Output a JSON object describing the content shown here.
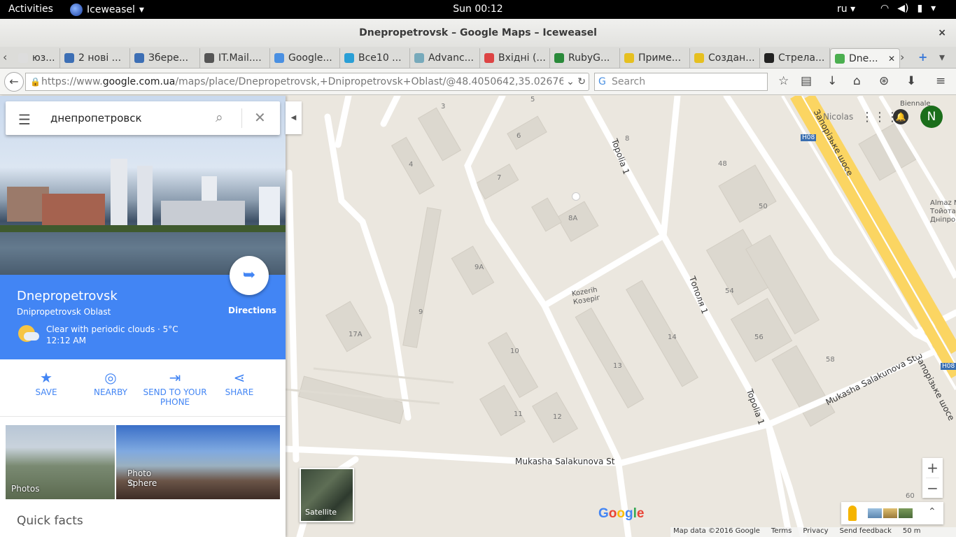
{
  "system": {
    "activities": "Activities",
    "app": "Iceweasel",
    "clock": "Sun 00:12",
    "lang": "ru"
  },
  "window": {
    "title": "Dnepropetrovsk – Google Maps – Iceweasel",
    "close": "×"
  },
  "tabs": [
    {
      "label": "юз...",
      "color": "#ddd"
    },
    {
      "label": "2 нові ...",
      "color": "#3d6fb5"
    },
    {
      "label": "Збере...",
      "color": "#3d6fb5"
    },
    {
      "label": "IT.Mail....",
      "color": "#555"
    },
    {
      "label": "Google...",
      "color": "#4a90e2"
    },
    {
      "label": "Все10 ...",
      "color": "#2a9fd6"
    },
    {
      "label": "Advanc...",
      "color": "#7ab"
    },
    {
      "label": "Вхідні (...",
      "color": "#d44"
    },
    {
      "label": "RubyG...",
      "color": "#2a8a3a"
    },
    {
      "label": "Приме...",
      "color": "#e6c020"
    },
    {
      "label": "Создан...",
      "color": "#e6c020"
    },
    {
      "label": "Стрела...",
      "color": "#222"
    },
    {
      "label": "Dne...",
      "color": "#4caf50"
    }
  ],
  "nav": {
    "url_prefix": "https://www.",
    "url_host": "google.com.ua",
    "url_path": "/maps/place/Dnepropetrovsk,+Dnipropetrovsk+Oblast/@48.4050642,35.0267639,1",
    "search_placeholder": "Search"
  },
  "panel": {
    "query": "днепропетровск",
    "place_name": "Dnepropetrovsk",
    "region": "Dnipropetrovsk Oblast",
    "weather": "Clear with periodic clouds · 5°C",
    "time": "12:12 AM",
    "directions": "Directions",
    "actions": [
      {
        "label": "SAVE",
        "icon": "★"
      },
      {
        "label": "NEARBY",
        "icon": "◎"
      },
      {
        "label": "SEND TO YOUR PHONE",
        "icon": "⇥"
      },
      {
        "label": "SHARE",
        "icon": "⋖"
      }
    ],
    "photos_label": "Photos",
    "photosphere_label": "Photo Sphere",
    "quick_facts": "Quick facts"
  },
  "map": {
    "labels": [
      {
        "t": "3"
      },
      {
        "t": "5"
      },
      {
        "t": "6"
      },
      {
        "t": "4"
      },
      {
        "t": "7"
      },
      {
        "t": "8"
      },
      {
        "t": "8A"
      },
      {
        "t": "9A"
      },
      {
        "t": "9"
      },
      {
        "t": "17A"
      },
      {
        "t": "10"
      },
      {
        "t": "11"
      },
      {
        "t": "12"
      },
      {
        "t": "13"
      },
      {
        "t": "14"
      },
      {
        "t": "54"
      },
      {
        "t": "56"
      },
      {
        "t": "58"
      },
      {
        "t": "50"
      },
      {
        "t": "48"
      },
      {
        "t": "60"
      }
    ],
    "poi": "Kozerih\nКозеріг",
    "streets": {
      "topolia1": "Topolia 1",
      "topolia1_ua": "Тополя 1",
      "topolia1_b": "Topolia 1",
      "mukasha1": "Mukasha Salakunova St",
      "mukasha2": "Mukasha Salakunova St",
      "zaporizke": "Запорізьке шосе",
      "nicolas": "Nicolas",
      "h08": "H08",
      "biennale": "Biennale",
      "almaz": "Almaz M\nТойота\nДніпро"
    },
    "satellite": "Satellite",
    "zoom_in": "+",
    "zoom_out": "−",
    "avatar": "N",
    "footer": [
      "Map data ©2016 Google",
      "Terms",
      "Privacy",
      "Send feedback",
      "50 m"
    ]
  }
}
